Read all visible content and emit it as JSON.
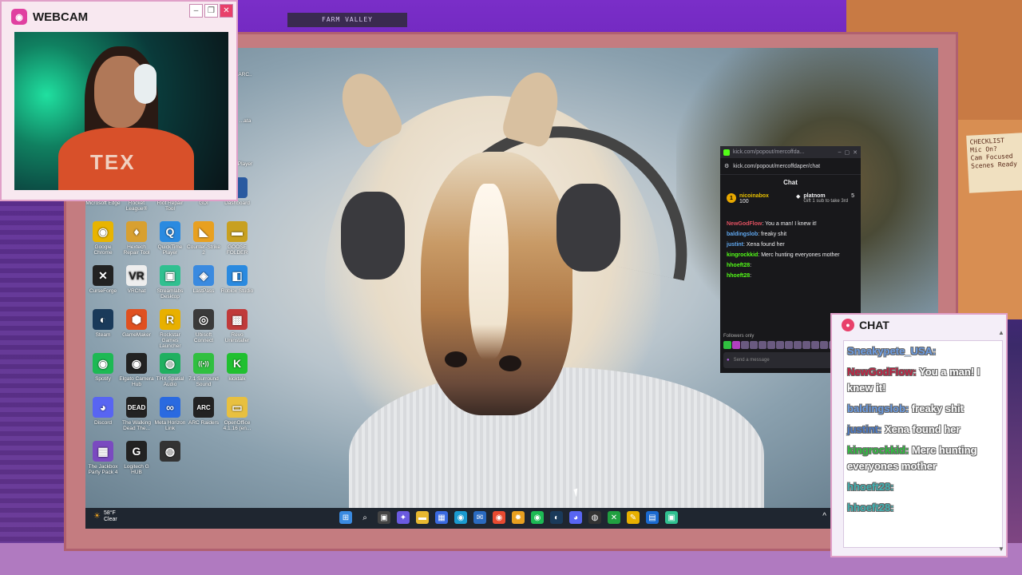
{
  "room": {
    "frame_label": "FARM VALLEY"
  },
  "note": {
    "lines": [
      "CHECKLIST",
      "Mic On?",
      "Cam Focused",
      "Scenes Ready"
    ]
  },
  "webcam": {
    "title": "WEBCAM",
    "shirt_text": "TEX"
  },
  "desktop": {
    "icons": [
      {
        "label": "Microsoft Edge",
        "glyph": "",
        "color": "#1a78c8"
      },
      {
        "label": "Rocket League®",
        "glyph": "",
        "color": "#2a6ab0"
      },
      {
        "label": "Riot Repair Tool",
        "glyph": "",
        "color": "#d03a3a"
      },
      {
        "label": "GDI",
        "glyph": "",
        "color": "#555"
      },
      {
        "label": "Dashboard",
        "glyph": "",
        "color": "#2a5aa0"
      },
      {
        "label": "Google Chrome",
        "glyph": "◉",
        "color": "#e8b400"
      },
      {
        "label": "Hextech Repair Tool",
        "glyph": "♦",
        "color": "#d8a030"
      },
      {
        "label": "QuickTime Player",
        "glyph": "Q",
        "color": "#2a8ae0"
      },
      {
        "label": "Counter-Strike 2",
        "glyph": "◣",
        "color": "#e8a020"
      },
      {
        "label": "GOOSE FOLDER",
        "glyph": "▬",
        "color": "#c8a020"
      },
      {
        "label": "CurseForge",
        "glyph": "✕",
        "color": "#222"
      },
      {
        "label": "VRChat",
        "glyph": "VR",
        "color": "#eee"
      },
      {
        "label": "Streamlabs Desktop",
        "glyph": "▣",
        "color": "#30c090"
      },
      {
        "label": "LastPass",
        "glyph": "◈",
        "color": "#3a8ae0"
      },
      {
        "label": "Roblox Studio",
        "glyph": "◧",
        "color": "#2a8ae0"
      },
      {
        "label": "Steam",
        "glyph": "◐",
        "color": "#1a3a5a"
      },
      {
        "label": "GameMaker",
        "glyph": "⬢",
        "color": "#e05020"
      },
      {
        "label": "Rockstar Games Launcher",
        "glyph": "R",
        "color": "#e8b000"
      },
      {
        "label": "Ubisoft Connect",
        "glyph": "◎",
        "color": "#3a3a3a"
      },
      {
        "label": "Revo Uninstaller",
        "glyph": "▩",
        "color": "#c03a3a"
      },
      {
        "label": "Spotify",
        "glyph": "◉",
        "color": "#1db954"
      },
      {
        "label": "Elgato Camera Hub",
        "glyph": "◉",
        "color": "#222"
      },
      {
        "label": "THX Spatial Audio",
        "glyph": "◍",
        "color": "#20b060"
      },
      {
        "label": "7.1 Surround Sound",
        "glyph": "((•))",
        "color": "#30c040"
      },
      {
        "label": "kicktalk",
        "glyph": "K",
        "color": "#20c030"
      },
      {
        "label": "Discord",
        "glyph": "◕",
        "color": "#5865f2"
      },
      {
        "label": "The Walking Dead The...",
        "glyph": "DEAD",
        "color": "#222"
      },
      {
        "label": "Meta Horizon Link",
        "glyph": "∞",
        "color": "#2a6ae0"
      },
      {
        "label": "ARC Raiders",
        "glyph": "ARC",
        "color": "#222"
      },
      {
        "label": "OpenOffice 4.1.16 (en...",
        "glyph": "▭",
        "color": "#e8c040"
      },
      {
        "label": "The Jackbox Party Pack 4",
        "glyph": "▦",
        "color": "#7a4ac0"
      },
      {
        "label": "Logitech G HUB",
        "glyph": "G",
        "color": "#222"
      },
      {
        "label": "",
        "glyph": "◍",
        "color": "#333"
      }
    ],
    "partial_labels": [
      "ARC..",
      "...ata",
      "Player"
    ]
  },
  "taskbar": {
    "weather_temp": "58°F",
    "weather_desc": "Clear",
    "icons": [
      {
        "name": "start-icon",
        "glyph": "⊞",
        "color": "#3a8ae0"
      },
      {
        "name": "search-icon",
        "glyph": "⌕",
        "color": "#1f2630"
      },
      {
        "name": "task-view-icon",
        "glyph": "▣",
        "color": "#444"
      },
      {
        "name": "copilot-icon",
        "glyph": "✦",
        "color": "#6a5ae0"
      },
      {
        "name": "file-explorer-icon",
        "glyph": "▬",
        "color": "#e8b830"
      },
      {
        "name": "store-icon",
        "glyph": "▦",
        "color": "#3a6ae0"
      },
      {
        "name": "edge-icon",
        "glyph": "◉",
        "color": "#1a9ad0"
      },
      {
        "name": "mail-icon",
        "glyph": "✉",
        "color": "#2a6ac0"
      },
      {
        "name": "chrome-icon",
        "glyph": "◉",
        "color": "#e84a30"
      },
      {
        "name": "sun-app-icon",
        "glyph": "✹",
        "color": "#e8a020"
      },
      {
        "name": "spotify-icon",
        "glyph": "◉",
        "color": "#1db954"
      },
      {
        "name": "steam-icon",
        "glyph": "◐",
        "color": "#1a3a5a"
      },
      {
        "name": "discord-icon",
        "glyph": "◕",
        "color": "#5865f2"
      },
      {
        "name": "obs-icon",
        "glyph": "◍",
        "color": "#333"
      },
      {
        "name": "xbox-icon",
        "glyph": "✕",
        "color": "#20a040"
      },
      {
        "name": "pen-icon",
        "glyph": "✎",
        "color": "#e8b000"
      },
      {
        "name": "outlook-icon",
        "glyph": "▤",
        "color": "#1a6ad0"
      },
      {
        "name": "streamlabs-icon",
        "glyph": "▣",
        "color": "#30c090"
      }
    ],
    "tray_chevron": "^"
  },
  "kick": {
    "tab_url": "kick.com/popout/mercoffda...",
    "url": "kick.com/popout/mercoffdaper/chat",
    "header": "Chat",
    "gifters": [
      {
        "rank": "1",
        "name": "nicoinabox",
        "count": "100"
      },
      {
        "rank": "",
        "name": "platnom",
        "count": "5",
        "note": "Gift 1 sub to take 3rd"
      }
    ],
    "messages": [
      {
        "user": "NewGodFlow",
        "color": "#e05060",
        "text": "You a man! I knew it!"
      },
      {
        "user": "baldingslob",
        "color": "#60a8f0",
        "text": "freaky shit"
      },
      {
        "user": "justint",
        "color": "#60a8f0",
        "text": "Xena found her"
      },
      {
        "user": "kingrockkid",
        "color": "#53fc18",
        "text": "Merc hunting everyones mother"
      },
      {
        "user": "hhoeft28",
        "color": "#53fc18",
        "text": ""
      },
      {
        "user": "hhoeft28",
        "color": "#53fc18",
        "text": ""
      }
    ],
    "followers_only": "Followers only",
    "input_placeholder": "Send a message"
  },
  "overlay_chat": {
    "title": "CHAT",
    "messages": [
      {
        "user": "Sneakypete_USA",
        "color": "#6a9ae0",
        "text": ""
      },
      {
        "user": "NewGodFlow",
        "color": "#c02040",
        "text": "You a man! I knew it!"
      },
      {
        "user": "baldingslob",
        "color": "#6a9ae0",
        "text": "freaky shit"
      },
      {
        "user": "justint",
        "color": "#4a7ac8",
        "text": "Xena found her"
      },
      {
        "user": "kingrockkid",
        "color": "#30c040",
        "text": "Merc hunting everyones mother"
      },
      {
        "user": "hhoeft28",
        "color": "#40b0b0",
        "text": ""
      },
      {
        "user": "hhoeft28",
        "color": "#40b0b0",
        "text": ""
      }
    ]
  }
}
